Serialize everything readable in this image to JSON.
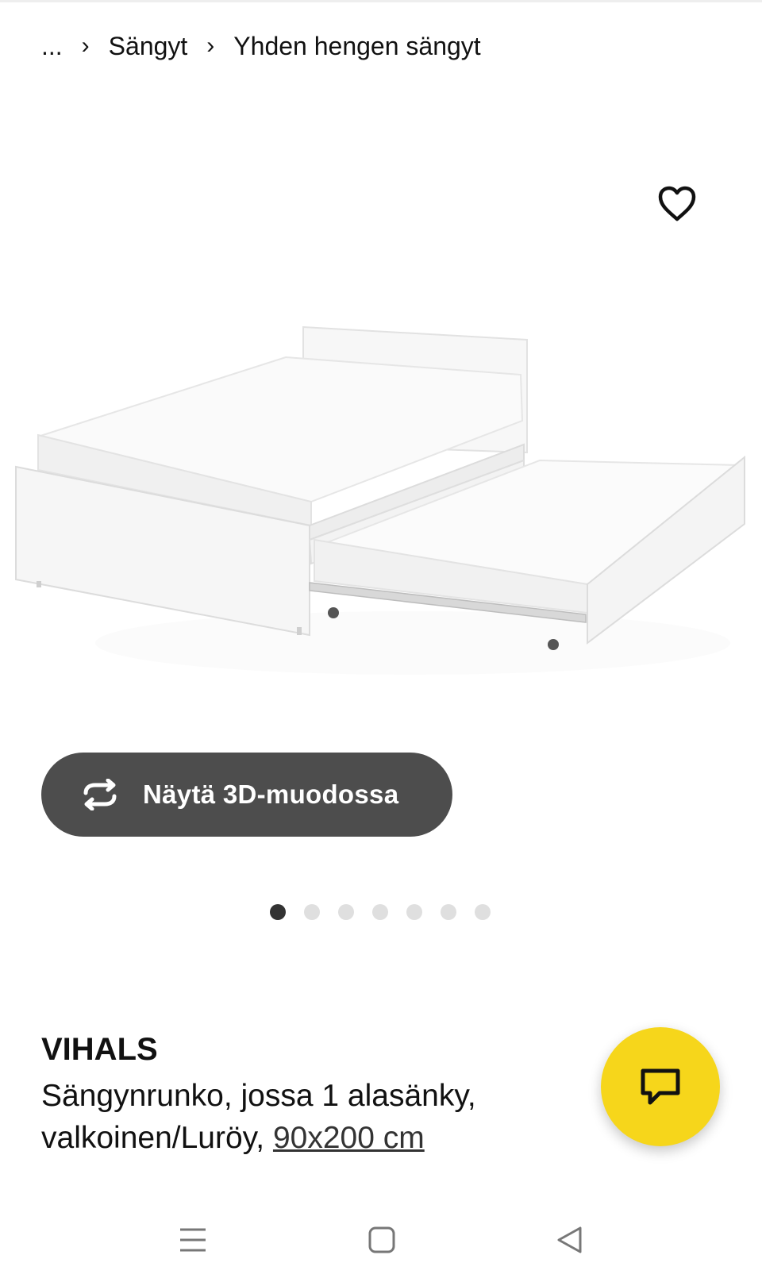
{
  "breadcrumb": {
    "ellipsis": "...",
    "separator": "›",
    "items": [
      "Sängyt",
      "Yhden hengen sängyt"
    ]
  },
  "image": {
    "favorite_icon": "heart-outline-icon",
    "alt": ""
  },
  "view_3d": {
    "icon": "rotate-arrows-icon",
    "label": "Näytä 3D-muodossa"
  },
  "carousel": {
    "total": 7,
    "active_index": 0
  },
  "product": {
    "name": "VIHALS",
    "description": "Sängynrunko, jossa 1 alasänky, valkoinen/Luröy, ",
    "size_link": "90x200 cm"
  },
  "chat": {
    "icon": "chat-bubble-icon",
    "color": "#f6d61b"
  },
  "navbar": {
    "menu_icon": "menu-icon",
    "home_icon": "home-square-icon",
    "back_icon": "back-triangle-icon"
  },
  "colors": {
    "button_dark": "#4d4d4d",
    "dot_active": "#333333",
    "dot_inactive": "#dfdfdf"
  }
}
